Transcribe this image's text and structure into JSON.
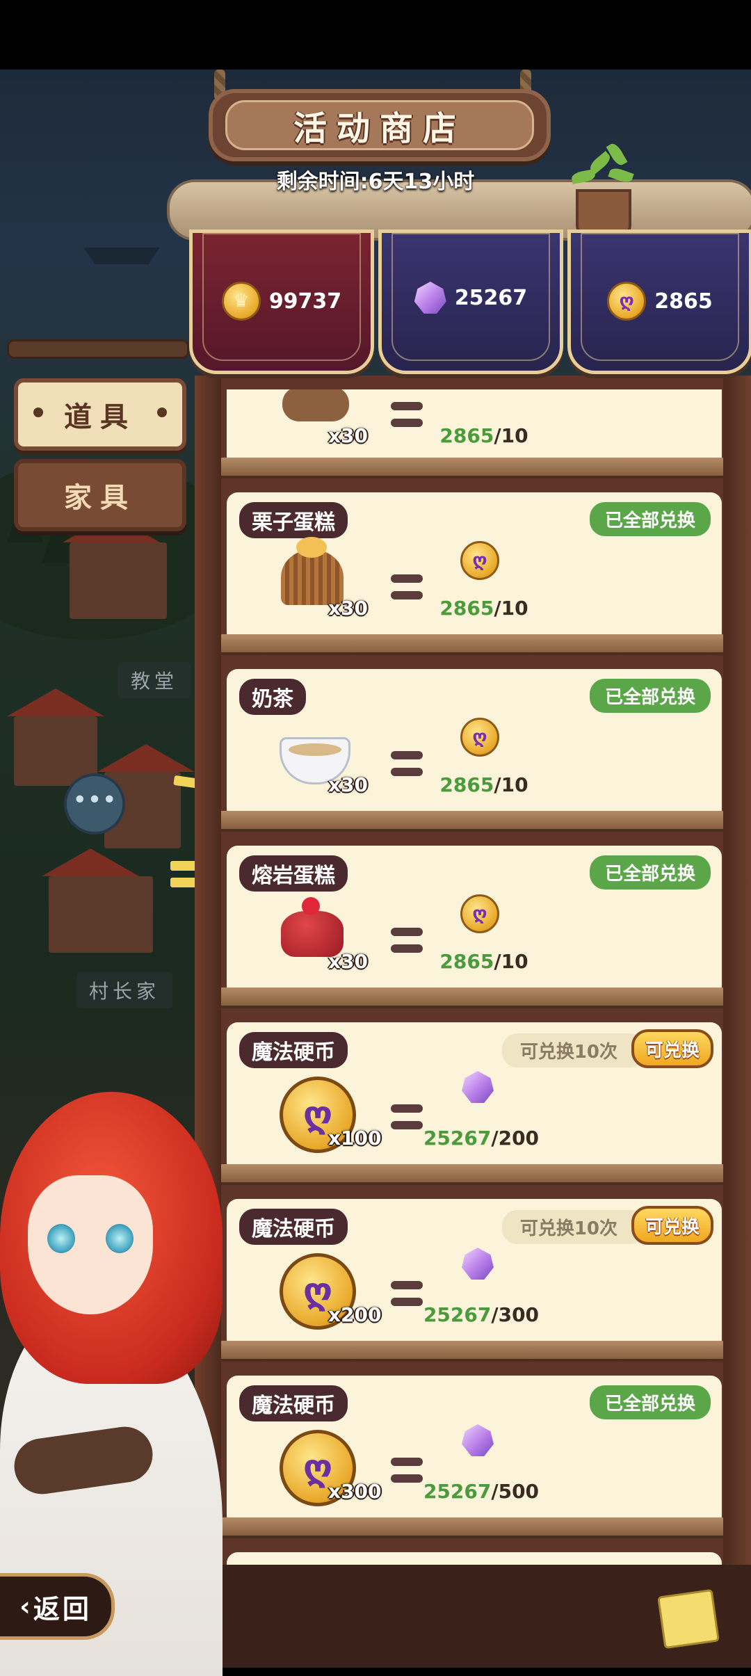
{
  "shop": {
    "title": "活动商店",
    "timer": "剩余时间:6天13小时"
  },
  "currencies": [
    {
      "icon": "crown-coin-icon",
      "value": "99737"
    },
    {
      "icon": "purple-gem-icon",
      "value": "25267"
    },
    {
      "icon": "magic-coin-icon",
      "value": "2865"
    }
  ],
  "tabs": [
    {
      "label": "道具",
      "active": true
    },
    {
      "label": "家具",
      "active": false
    }
  ],
  "map_signs": [
    "教堂",
    "村长家"
  ],
  "items": [
    {
      "name": "",
      "icon": "log-cake-icon",
      "qty": "x30",
      "cost_icon": "magic-coin-icon",
      "have": "2865",
      "need": "/10",
      "status": ""
    },
    {
      "name": "栗子蛋糕",
      "icon": "chestnut-cake-icon",
      "qty": "x30",
      "cost_icon": "magic-coin-icon",
      "have": "2865",
      "need": "/10",
      "status": "已全部兑换"
    },
    {
      "name": "奶茶",
      "icon": "milk-tea-icon",
      "qty": "x30",
      "cost_icon": "magic-coin-icon",
      "have": "2865",
      "need": "/10",
      "status": "已全部兑换"
    },
    {
      "name": "熔岩蛋糕",
      "icon": "lava-cake-icon",
      "qty": "x30",
      "cost_icon": "magic-coin-icon",
      "have": "2865",
      "need": "/10",
      "status": "已全部兑换"
    },
    {
      "name": "魔法硬币",
      "icon": "magic-coin-icon",
      "qty": "x100",
      "cost_icon": "purple-gem-icon",
      "have": "25267",
      "need": "/200",
      "limit": "可兑换10次",
      "button": "可兑换"
    },
    {
      "name": "魔法硬币",
      "icon": "magic-coin-icon",
      "qty": "x200",
      "cost_icon": "purple-gem-icon",
      "have": "25267",
      "need": "/300",
      "limit": "可兑换10次",
      "button": "可兑换"
    },
    {
      "name": "魔法硬币",
      "icon": "magic-coin-icon",
      "qty": "x300",
      "cost_icon": "purple-gem-icon",
      "have": "25267",
      "need": "/500",
      "status": "已全部兑换"
    }
  ],
  "back_button": "返回",
  "colors": {
    "owned_green": "#4b9a3c",
    "status_green": "#5aa648",
    "name_tag": "#4a2a2e",
    "shelf_wood": "#5e3528"
  }
}
